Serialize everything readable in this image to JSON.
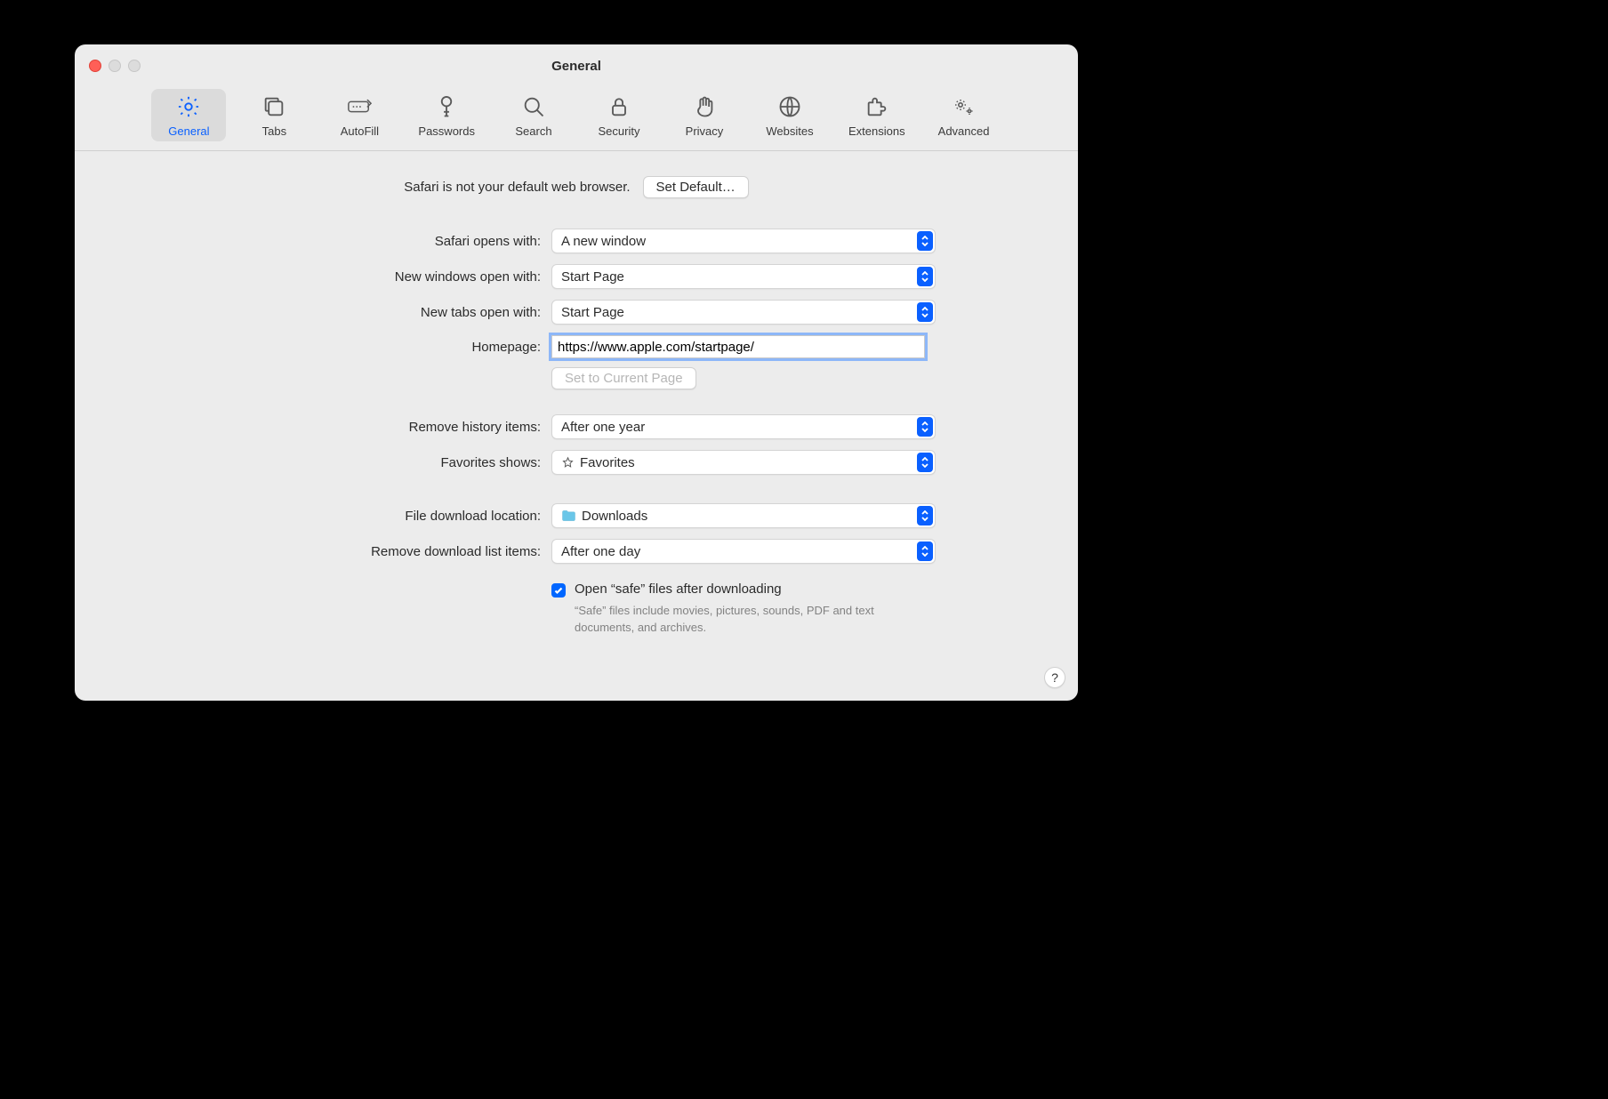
{
  "window": {
    "title": "General"
  },
  "toolbar": [
    {
      "name": "general",
      "label": "General",
      "icon": "gear-icon",
      "active": true
    },
    {
      "name": "tabs",
      "label": "Tabs",
      "icon": "tabs-icon",
      "active": false
    },
    {
      "name": "autofill",
      "label": "AutoFill",
      "icon": "autofill-icon",
      "active": false
    },
    {
      "name": "passwords",
      "label": "Passwords",
      "icon": "key-icon",
      "active": false
    },
    {
      "name": "search",
      "label": "Search",
      "icon": "search-icon",
      "active": false
    },
    {
      "name": "security",
      "label": "Security",
      "icon": "lock-icon",
      "active": false
    },
    {
      "name": "privacy",
      "label": "Privacy",
      "icon": "hand-icon",
      "active": false
    },
    {
      "name": "websites",
      "label": "Websites",
      "icon": "globe-icon",
      "active": false
    },
    {
      "name": "extensions",
      "label": "Extensions",
      "icon": "puzzle-icon",
      "active": false
    },
    {
      "name": "advanced",
      "label": "Advanced",
      "icon": "gears-icon",
      "active": false
    }
  ],
  "default_browser": {
    "message": "Safari is not your default web browser.",
    "button": "Set Default…"
  },
  "fields": {
    "opens_with": {
      "label": "Safari opens with:",
      "value": "A new window"
    },
    "new_windows": {
      "label": "New windows open with:",
      "value": "Start Page"
    },
    "new_tabs": {
      "label": "New tabs open with:",
      "value": "Start Page"
    },
    "homepage": {
      "label": "Homepage:",
      "value": "https://www.apple.com/startpage/"
    },
    "set_current": {
      "label": "Set to Current Page"
    },
    "history": {
      "label": "Remove history items:",
      "value": "After one year"
    },
    "favorites": {
      "label": "Favorites shows:",
      "value": "Favorites"
    },
    "download_loc": {
      "label": "File download location:",
      "value": "Downloads"
    },
    "download_remove": {
      "label": "Remove download list items:",
      "value": "After one day"
    },
    "safe_files": {
      "label": "Open “safe” files after downloading",
      "checked": true,
      "description": "“Safe” files include movies, pictures, sounds, PDF and text documents, and archives."
    }
  },
  "help_label": "?"
}
